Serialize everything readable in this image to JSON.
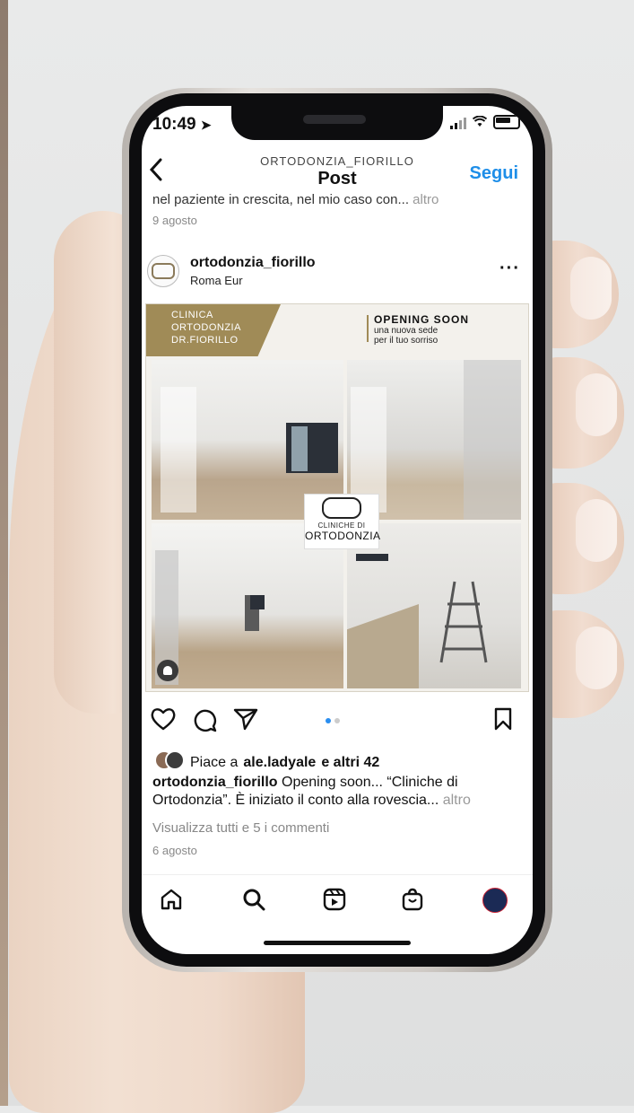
{
  "status_bar": {
    "time": "10:49"
  },
  "header": {
    "username": "ORTODONZIA_FIORILLO",
    "title": "Post",
    "follow_label": "Segui"
  },
  "previous_post": {
    "caption": "nel paziente in crescita, nel mio caso con...",
    "more_label": "altro",
    "date": "9 agosto"
  },
  "post": {
    "username": "ortodonzia_fiorillo",
    "location": "Roma Eur",
    "image": {
      "banner_lines": [
        "CLINICA",
        "ORTODONZIA",
        "DR.FIORILLO"
      ],
      "opening_title": "OPENING SOON",
      "opening_sub": [
        "una nuova sede",
        "per il tuo sorriso"
      ],
      "logo_line1": "CLINICHE DI",
      "logo_line2": "ORTODONZIA"
    },
    "likes_prefix": "Piace a",
    "likes_user": "ale.ladyale",
    "likes_suffix": "e altri 42",
    "caption_user": "ortodonzia_fiorillo",
    "caption_text": "Opening soon... “Cliniche di Ortodonzia”. È iniziato il conto alla rovescia...",
    "caption_more": "altro",
    "view_comments": "Visualizza tutti e 5 i commenti",
    "date": "6 agosto",
    "carousel": {
      "index": 1,
      "total": 2
    }
  },
  "icons": {
    "back": "chevron-left-icon",
    "like": "heart-icon",
    "comment": "comment-icon",
    "share": "send-icon",
    "save": "bookmark-icon",
    "nav": [
      "home-icon",
      "search-icon",
      "reels-icon",
      "shop-icon",
      "profile-icon"
    ]
  },
  "colors": {
    "accent": "#1e8ee8",
    "brand_gold": "#a08b57"
  }
}
